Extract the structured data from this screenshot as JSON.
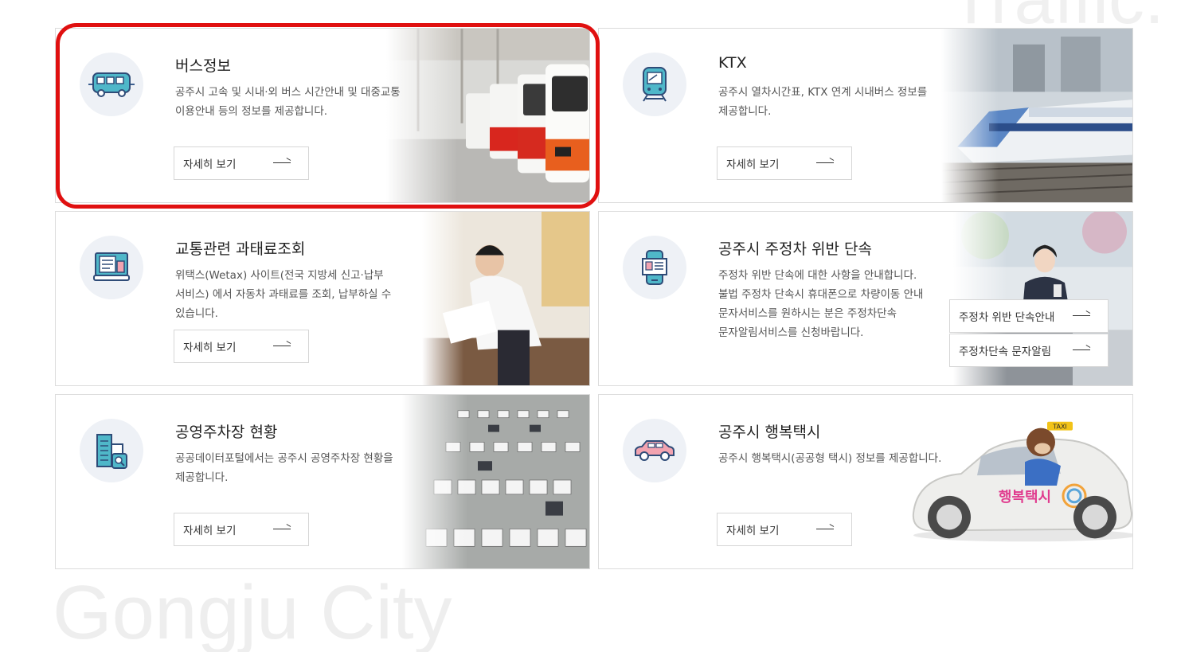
{
  "watermarks": {
    "top": "Traffic.",
    "bottom": "Gongju City"
  },
  "common": {
    "more_label": "자세히 보기"
  },
  "cards": [
    {
      "title": "버스정보",
      "desc": [
        "공주시 고속 및 시내·외 버스 시간안내 및 대중교통",
        "이용안내 등의 정보를 제공합니다."
      ],
      "icon": "bus-icon"
    },
    {
      "title": "KTX",
      "desc": [
        "공주시 열차시간표, KTX 연계 시내버스 정보를",
        "제공합니다."
      ],
      "icon": "train-icon"
    },
    {
      "title": "교통관련 과태료조회",
      "desc": [
        "위택스(Wetax) 사이트(전국 지방세 신고·납부",
        "서비스) 에서 자동차 과태료를 조회, 납부하실 수",
        "있습니다."
      ],
      "icon": "computer-checklist-icon"
    },
    {
      "title": "공주시 주정차 위반 단속",
      "desc": [
        "주정차 위반 단속에 대한 사항을 안내합니다.",
        "불법 주정차 단속시 휴대폰으로 차량이동 안내",
        "문자서비스를 원하시는 분은 주정차단속",
        "문자알림서비스를 신청바랍니다."
      ],
      "icon": "mobile-notice-icon",
      "buttons": [
        "주정차 위반 단속안내",
        "주정차단속 문자알림"
      ]
    },
    {
      "title": "공영주차장 현황",
      "desc": [
        "공공데이터포털에서는 공주시 공영주차장 현황을",
        "제공합니다."
      ],
      "icon": "building-search-icon"
    },
    {
      "title": "공주시 행복택시",
      "desc": [
        "공주시 행복택시(공공형 택시) 정보를 제공합니다."
      ],
      "icon": "car-icon",
      "photo_text": {
        "sign": "TAXI",
        "brand": "행복택시"
      }
    }
  ],
  "colors": {
    "highlight": "#e01010",
    "icon_bg": "#eef1f6",
    "icon_blue": "#3c5f8f",
    "icon_teal": "#4fb7c9",
    "icon_pink": "#f2a3b0"
  }
}
